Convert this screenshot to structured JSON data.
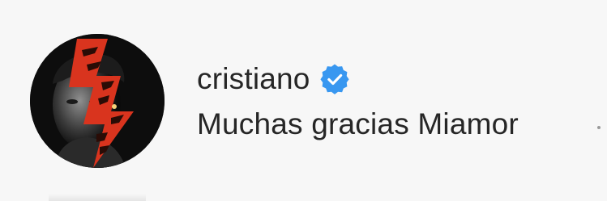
{
  "comment": {
    "username": "cristiano",
    "verified_icon": "verified-badge-icon",
    "text": "Muchas gracias Miamor"
  },
  "colors": {
    "background": "#f7f7f7",
    "text": "#262626",
    "verified_badge": "#3897f0",
    "avatar_accent": "#d9341e"
  }
}
